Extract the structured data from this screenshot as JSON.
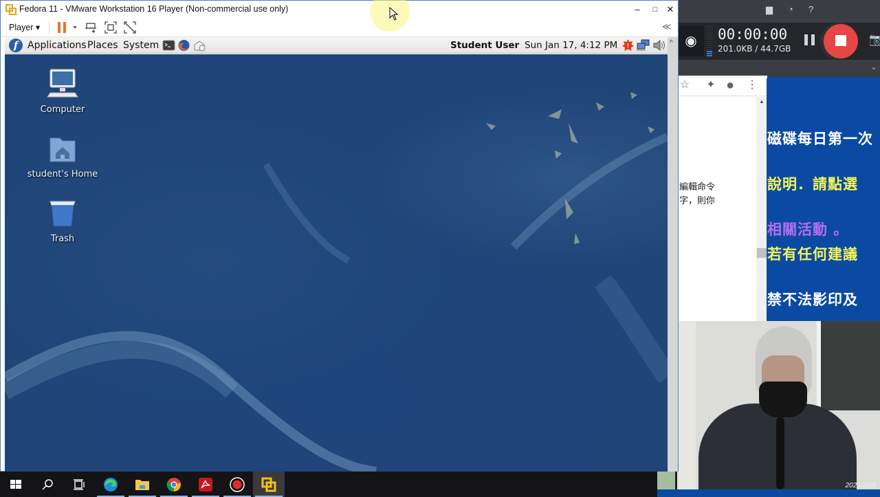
{
  "vmware": {
    "title": "Fedora 11 - VMware Workstation 16 Player (Non-commercial use only)",
    "controls": {
      "minimize": "–",
      "maximize": "□",
      "close": "✕"
    },
    "toolbar": {
      "player_menu": "Player ▾",
      "icons": [
        "pause-icon",
        "send-ctrl-alt-del-icon",
        "fit-guest-icon",
        "unity-icon"
      ],
      "collapse": "≪"
    },
    "scrollbar_up": "^"
  },
  "guest": {
    "panel": {
      "menus": [
        "Applications",
        "Places",
        "System"
      ],
      "launchers": [
        "terminal-icon",
        "firefox-icon",
        "mail-icon"
      ],
      "user": "Student User",
      "clock": "Sun Jan 17,  4:12 PM",
      "tray": [
        "update-alert-icon",
        "network-icon",
        "volume-icon"
      ]
    },
    "desktop_icons": [
      {
        "label": "Computer",
        "icon": "computer-icon"
      },
      {
        "label": "student's Home",
        "icon": "home-folder-icon"
      },
      {
        "label": "Trash",
        "icon": "trash-icon"
      }
    ]
  },
  "recorder": {
    "timer": "00:00:00",
    "size": "201.0KB / 44.7GB",
    "recording": true,
    "level": 0.15
  },
  "browser_fragment": {
    "lines": [
      "編輯命令",
      "字，則你"
    ]
  },
  "slide_fragment": {
    "lines": [
      {
        "text": "磁碟每日第一次",
        "color": "#ffffff"
      },
      {
        "text": "說明．請點選",
        "color": "#f3f35a"
      },
      {
        "text": "相關活動 。",
        "color": "#b56cf0"
      },
      {
        "text": "若有任何建議",
        "color": "#f3f35a"
      },
      {
        "text": "禁不法影印及",
        "color": "#ffffff"
      }
    ]
  },
  "webcam": {
    "date_stamp": "2021/2/25"
  },
  "taskbar": {
    "items": [
      "start-button",
      "search-button",
      "task-view-button",
      "edge-app",
      "file-explorer-app",
      "chrome-app",
      "acrobat-app",
      "recorder-app",
      "vmware-player-app"
    ],
    "active": "vmware-player-app"
  }
}
